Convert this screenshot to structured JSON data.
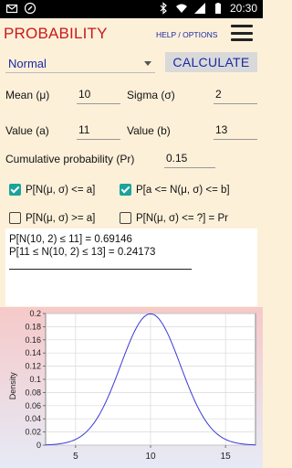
{
  "statusbar": {
    "time": "20:30"
  },
  "header": {
    "title": "PROBABILITY",
    "help": "HELP / OPTIONS"
  },
  "distribution": {
    "selected": "Normal"
  },
  "calculate_label": "CALCULATE",
  "params": {
    "mean_label": "Mean (μ)",
    "mean": "10",
    "sigma_label": "Sigma (σ)",
    "sigma": "2",
    "a_label": "Value (a)",
    "a": "11",
    "b_label": "Value (b)",
    "b": "13",
    "pr_label": "Cumulative probability (Pr)",
    "pr": "0.15"
  },
  "options": [
    {
      "label": "P[N(μ, σ) <= a]",
      "checked": true
    },
    {
      "label": "P[a <= N(μ, σ) <= b]",
      "checked": true
    },
    {
      "label": "P[N(μ, σ) >= a]",
      "checked": false
    },
    {
      "label": "P[N(μ, σ) <= ?] = Pr",
      "checked": false
    }
  ],
  "results": [
    "P[N(10, 2) ≤ 11] = 0.69146",
    "P[11 ≤ N(10, 2) ≤ 13] = 0.24173"
  ],
  "chart_data": {
    "type": "line",
    "ylabel": "Density",
    "xlabel": "",
    "xlim": [
      3,
      17
    ],
    "ylim": [
      0,
      0.2
    ],
    "x_ticks": [
      5,
      10,
      15
    ],
    "y_ticks": [
      0,
      0.02,
      0.04,
      0.06,
      0.08,
      0.1,
      0.12,
      0.14,
      0.16,
      0.18,
      0.2
    ],
    "y_tick_labels": [
      "0",
      "0.02",
      "0.04",
      "0.06",
      "0.08",
      "0.1",
      "0.12",
      "0.14",
      "0.16",
      "0.18",
      "0.2"
    ],
    "series": [
      {
        "color": "#3a3ad6",
        "mean": 10,
        "sigma": 2,
        "x": [
          3,
          4,
          5,
          6,
          7,
          7.5,
          8,
          8.5,
          9,
          9.5,
          10,
          10.5,
          11,
          11.5,
          12,
          12.5,
          13,
          14,
          15,
          16,
          17
        ],
        "y": [
          0.0004,
          0.0022,
          0.0088,
          0.027,
          0.0648,
          0.0913,
          0.121,
          0.1506,
          0.176,
          0.1933,
          0.1995,
          0.1933,
          0.176,
          0.1506,
          0.121,
          0.0913,
          0.0648,
          0.027,
          0.0088,
          0.0022,
          0.0004
        ]
      }
    ],
    "grid": true
  }
}
